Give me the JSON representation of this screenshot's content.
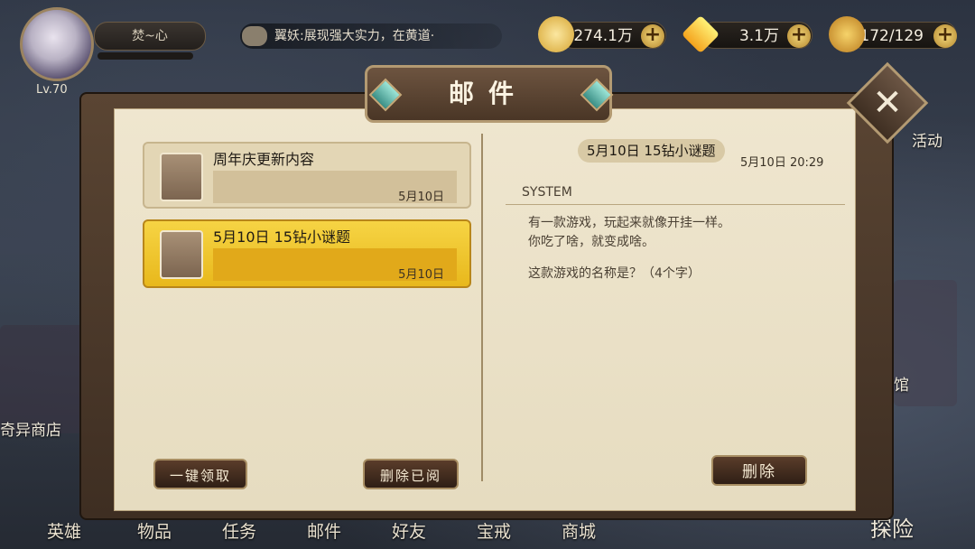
{
  "player": {
    "level": "Lv.70",
    "name": "焚~心"
  },
  "chat": {
    "text": "翼妖:展现强大实力，在黄道·"
  },
  "resources": [
    {
      "name": "gold",
      "value": "274.1万",
      "icon": "gold-coin-icon"
    },
    {
      "name": "diamond",
      "value": "3.1万",
      "icon": "diamond-icon"
    },
    {
      "name": "stamina",
      "value": "172/129",
      "icon": "stamina-icon"
    }
  ],
  "side_labels": {
    "activity": "活动",
    "shop": "奇异商店",
    "hall": "馆",
    "explore": "探险"
  },
  "bottom_tabs": [
    "英雄",
    "物品",
    "任务",
    "邮件",
    "好友",
    "宝戒",
    "商城"
  ],
  "dialog": {
    "title": "邮件"
  },
  "mails": [
    {
      "title": "周年庆更新内容",
      "date": "5月10日"
    },
    {
      "title": "5月10日 15钻小谜题",
      "date": "5月10日"
    }
  ],
  "detail": {
    "title": "5月10日 15钻小谜题",
    "time": "5月10日 20:29",
    "sender": "SYSTEM",
    "body": [
      "有一款游戏，玩起来就像开挂一样。",
      "你吃了啥，就变成啥。",
      "",
      "这款游戏的名称是？（4个字）"
    ]
  },
  "buttons": {
    "claim_all": "一键领取",
    "delete_read": "删除已阅",
    "delete": "删除"
  }
}
